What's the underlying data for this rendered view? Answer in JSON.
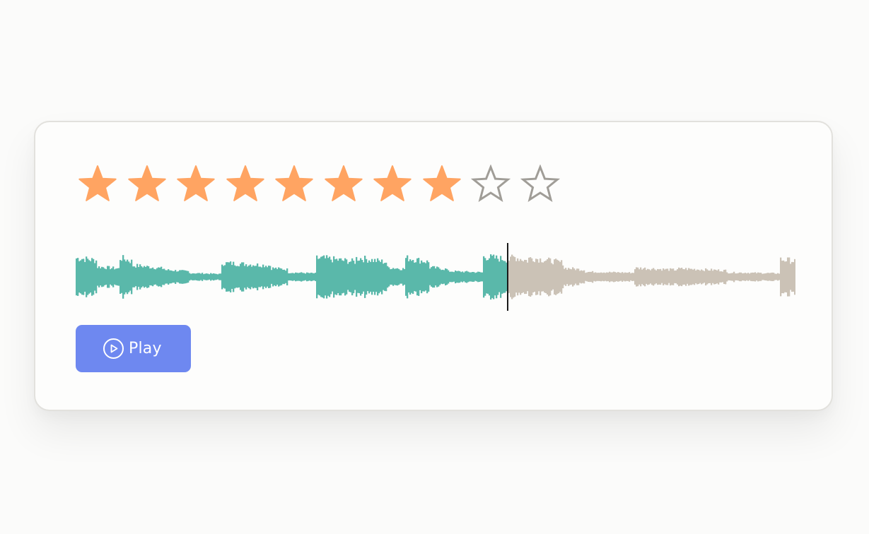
{
  "rating": {
    "value": 8,
    "max": 10,
    "filled_color": "#ffa462",
    "empty_color": "#a09d97"
  },
  "waveform": {
    "progress": 0.6,
    "played_color": "#5ab8aa",
    "unplayed_color": "#cbc2b6",
    "playhead_color": "#1a1a1a"
  },
  "player": {
    "play_label": "Play",
    "play_icon": "play-circle-icon",
    "button_color": "#6e88f0"
  }
}
